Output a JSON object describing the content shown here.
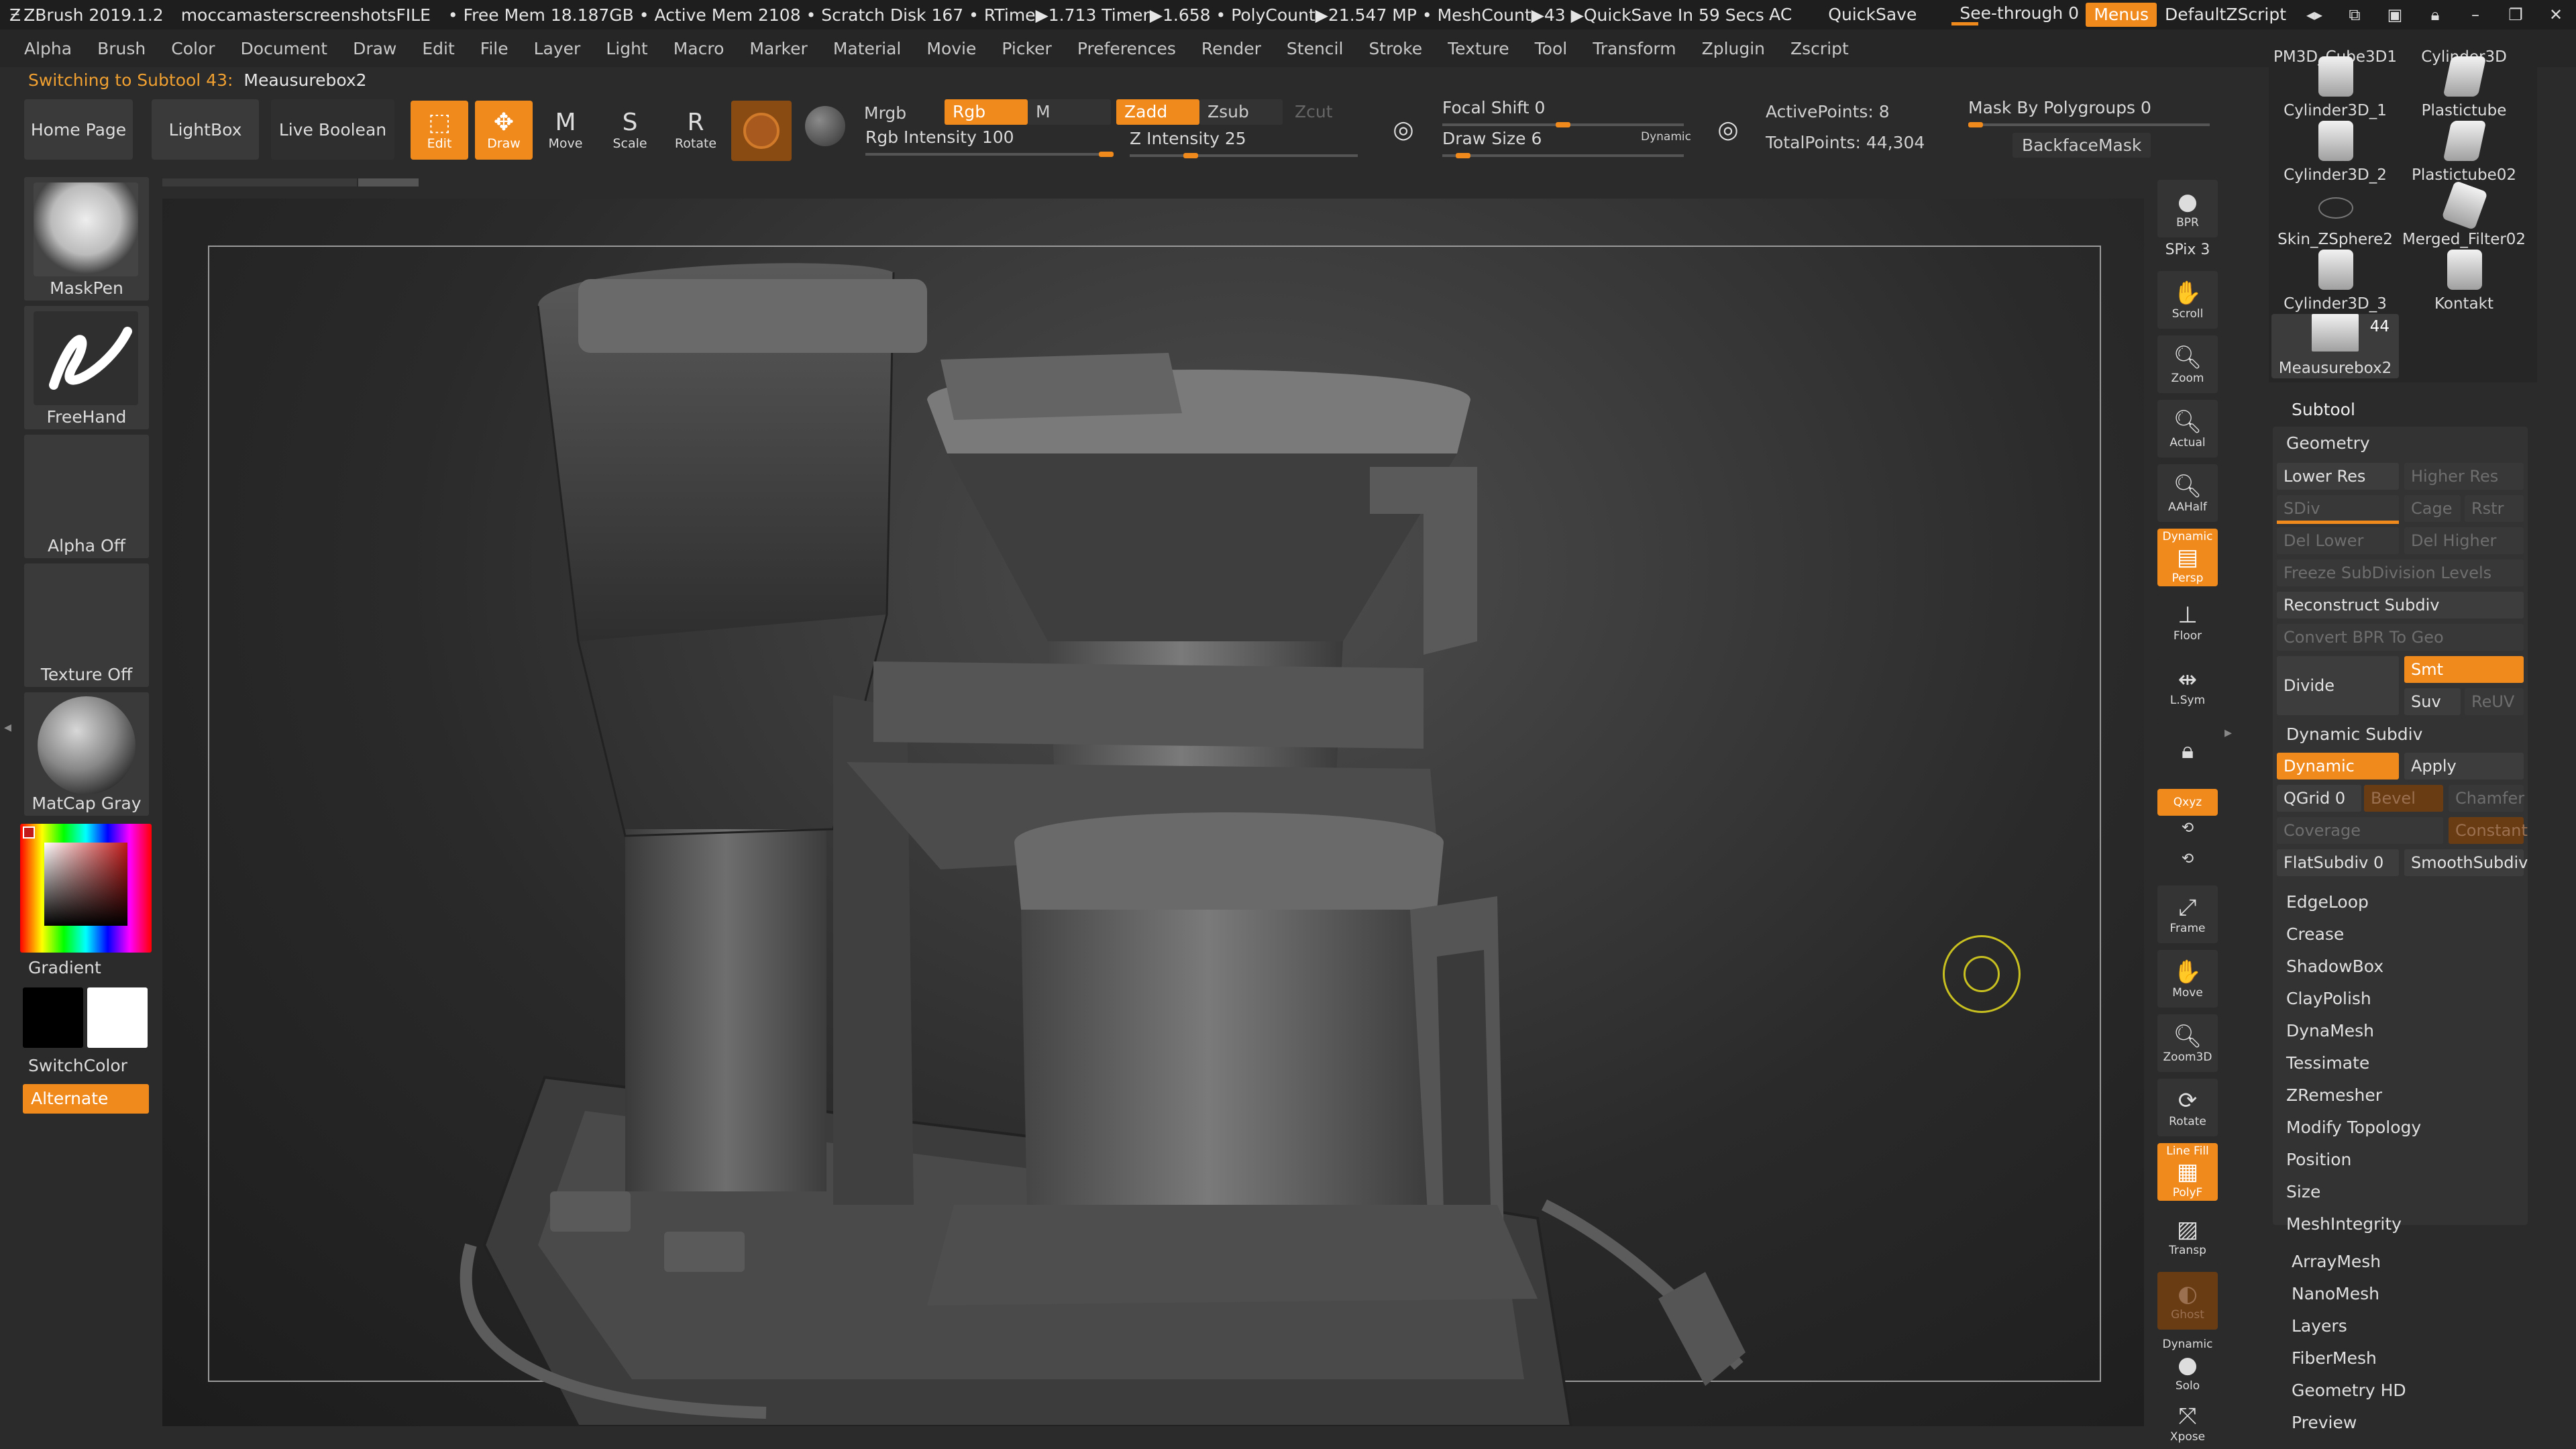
{
  "titlebar": {
    "app": "ZBrush 2019.1.2",
    "file": "moccamasterscreenshotsFILE",
    "stats": "• Free Mem 18.187GB • Active Mem 2108 • Scratch Disk 167 • RTime▶1.713 Timer▶1.658 • PolyCount▶21.547 MP • MeshCount▶43 ▶QuickSave In 59 Secs",
    "ac": "AC",
    "quicksave": "QuickSave",
    "see_through": "See-through  0",
    "menus": "Menus",
    "default_zscript": "DefaultZScript"
  },
  "menu": [
    "Alpha",
    "Brush",
    "Color",
    "Document",
    "Draw",
    "Edit",
    "File",
    "Layer",
    "Light",
    "Macro",
    "Marker",
    "Material",
    "Movie",
    "Picker",
    "Preferences",
    "Render",
    "Stencil",
    "Stroke",
    "Texture",
    "Tool",
    "Transform",
    "Zplugin",
    "Zscript"
  ],
  "notice": {
    "prefix": "Switching to Subtool 43:",
    "name": "Meausurebox2"
  },
  "toolbar": {
    "home_page": "Home Page",
    "lightbox": "LightBox",
    "live_boolean": "Live Boolean",
    "edit": "Edit",
    "draw": "Draw",
    "move": "Move",
    "scale": "Scale",
    "rotate": "Rotate",
    "mrgb": "Mrgb",
    "rgb": "Rgb",
    "m": "M",
    "zadd": "Zadd",
    "zsub": "Zsub",
    "zcut": "Zcut",
    "rgb_intensity": "Rgb Intensity 100",
    "z_intensity": "Z Intensity 25",
    "focal_shift": "Focal Shift 0",
    "draw_size": "Draw Size 6",
    "dynamic": "Dynamic",
    "active_points": "ActivePoints: 8",
    "total_points": "TotalPoints: 44,304",
    "mask_by_polygroups": "Mask By Polygroups 0",
    "backface_mask": "BackfaceMask",
    "rgb_intensity_level": 1.0,
    "z_intensity_level": 0.25,
    "focal_shift_level": 0.5,
    "draw_size_level": 0.06
  },
  "left": {
    "maskpen": "MaskPen",
    "freehand": "FreeHand",
    "alpha_off": "Alpha Off",
    "texture_off": "Texture Off",
    "matcap": "MatCap Gray",
    "gradient": "Gradient",
    "switchcolor": "SwitchColor",
    "alternate": "Alternate"
  },
  "shelf": {
    "bpr": "BPR",
    "spix": "SPix 3",
    "scroll": "Scroll",
    "zoom": "Zoom",
    "actual": "Actual",
    "aahalf": "AAHalf",
    "persp_dynamic": "Dynamic",
    "persp": "Persp",
    "floor": "Floor",
    "lsym": "L.Sym",
    "xyz": "Qxyz",
    "frame": "Frame",
    "move": "Move",
    "zoom3d": "Zoom3D",
    "rotate": "Rotate",
    "linefill": "Line Fill",
    "polyf": "PolyF",
    "transp": "Transp",
    "ghost": "Ghost",
    "solo_dynamic": "Dynamic",
    "solo": "Solo",
    "xpose": "Xpose"
  },
  "subtools": [
    {
      "name": "PM3D_Cube3D1"
    },
    {
      "name": "Cylinder3D"
    },
    {
      "name": "Cylinder3D_1"
    },
    {
      "name": "Plastictube"
    },
    {
      "name": "Cylinder3D_2"
    },
    {
      "name": "Plastictube02"
    },
    {
      "name": "Skin_ZSphere2"
    },
    {
      "name": "Merged_Filter02"
    },
    {
      "name": "Cylinder3D_3"
    },
    {
      "name": "Kontakt"
    },
    {
      "name": "Meausurebox2",
      "count": "44",
      "selected": true
    }
  ],
  "panel": {
    "subtool": "Subtool",
    "geometry": "Geometry",
    "lower_res": "Lower Res",
    "higher_res": "Higher Res",
    "sdiv": "SDiv",
    "cage": "Cage",
    "rstr": "Rstr",
    "del_lower": "Del Lower",
    "del_higher": "Del Higher",
    "freeze": "Freeze SubDivision Levels",
    "reconstruct": "Reconstruct Subdiv",
    "convert_bpr": "Convert BPR To Geo",
    "divide": "Divide",
    "smt": "Smt",
    "suv": "Suv",
    "reuv": "ReUV",
    "dynamic_subdiv": "Dynamic Subdiv",
    "dynamic": "Dynamic",
    "apply": "Apply",
    "qgrid": "QGrid 0",
    "bevel": "Bevel",
    "chamfer": "Chamfer",
    "coverage": "Coverage",
    "constant": "Constant",
    "flatsubdiv": "FlatSubdiv 0",
    "smoothsubdiv": "SmoothSubdiv",
    "geo_list": [
      "EdgeLoop",
      "Crease",
      "ShadowBox",
      "ClayPolish",
      "DynaMesh",
      "Tessimate",
      "ZRemesher",
      "Modify Topology",
      "Position",
      "Size",
      "MeshIntegrity"
    ],
    "after_list": [
      "ArrayMesh",
      "NanoMesh",
      "Layers",
      "FiberMesh",
      "Geometry HD",
      "Preview"
    ]
  }
}
